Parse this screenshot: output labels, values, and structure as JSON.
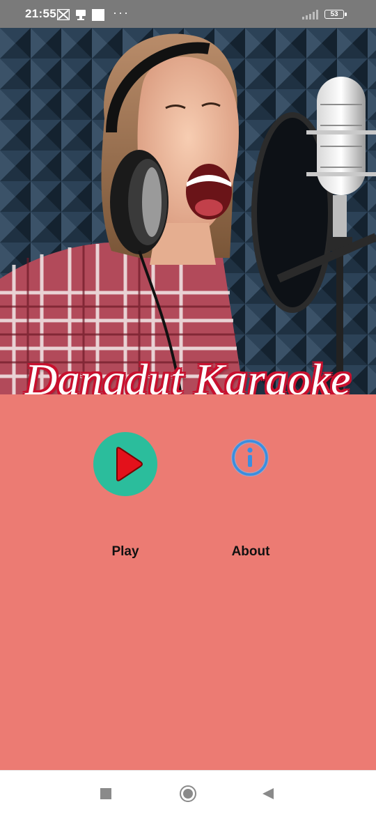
{
  "status_bar": {
    "time": "21:55",
    "icons": [
      "grid-app-icon",
      "usb-icon",
      "square-notification-icon"
    ],
    "more": "···",
    "battery": "53"
  },
  "banner": {
    "title": "Dangdut Karaoke",
    "image": "woman-singing-into-studio-microphone-photo"
  },
  "main": {
    "background": "#ec7b73",
    "play_button": {
      "label": "Play",
      "icon": "play-icon",
      "color": "#2bbd9c",
      "icon_color": "#e3111b"
    },
    "about_button": {
      "label": "About",
      "icon": "info-icon",
      "color": "#3a8ee0"
    }
  },
  "nav_bar": {
    "buttons": [
      "recents-square-icon",
      "home-circle-icon",
      "back-triangle-icon"
    ]
  }
}
